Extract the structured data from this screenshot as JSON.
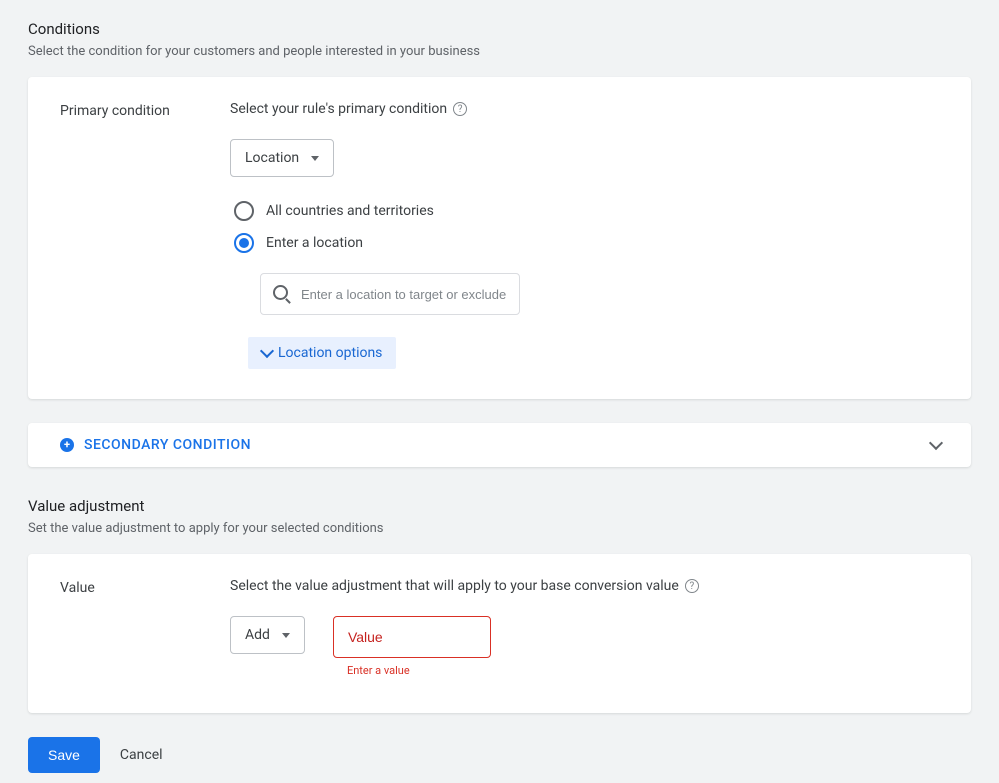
{
  "conditions": {
    "title": "Conditions",
    "desc": "Select the condition for your customers and people interested in your business",
    "primary": {
      "label": "Primary condition",
      "instr": "Select your rule's primary condition",
      "dropdown_value": "Location",
      "radio": {
        "all": "All countries and territories",
        "enter": "Enter a location"
      },
      "search_placeholder": "Enter a location to target or exclude",
      "options_toggle": "Location options"
    },
    "secondary_label": "SECONDARY CONDITION"
  },
  "value_adj": {
    "title": "Value adjustment",
    "desc": "Set the value adjustment to apply for your selected conditions",
    "label": "Value",
    "instr": "Select the value adjustment that will apply to your base conversion value",
    "op_dropdown": "Add",
    "input_placeholder": "Value",
    "error": "Enter a value"
  },
  "footer": {
    "save": "Save",
    "cancel": "Cancel"
  }
}
